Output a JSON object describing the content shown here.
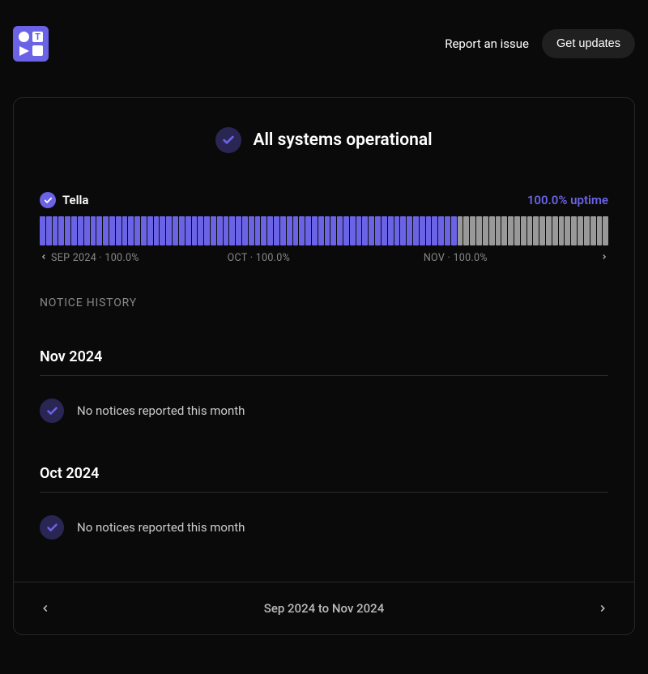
{
  "header": {
    "report_link": "Report an issue",
    "updates_button": "Get updates"
  },
  "status": {
    "title": "All systems operational"
  },
  "service": {
    "name": "Tella",
    "uptime_label": "100.0% uptime",
    "total_bars": 90,
    "filled_bars": 66,
    "months": {
      "sep": "SEP 2024 · 100.0%",
      "oct": "OCT · 100.0%",
      "nov": "NOV · 100.0%"
    }
  },
  "notice_history": {
    "label": "NOTICE HISTORY",
    "months": [
      {
        "title": "Nov 2024",
        "message": "No notices reported this month"
      },
      {
        "title": "Oct 2024",
        "message": "No notices reported this month"
      }
    ],
    "range": "Sep 2024 to Nov 2024"
  },
  "colors": {
    "accent": "#6b63e6"
  }
}
